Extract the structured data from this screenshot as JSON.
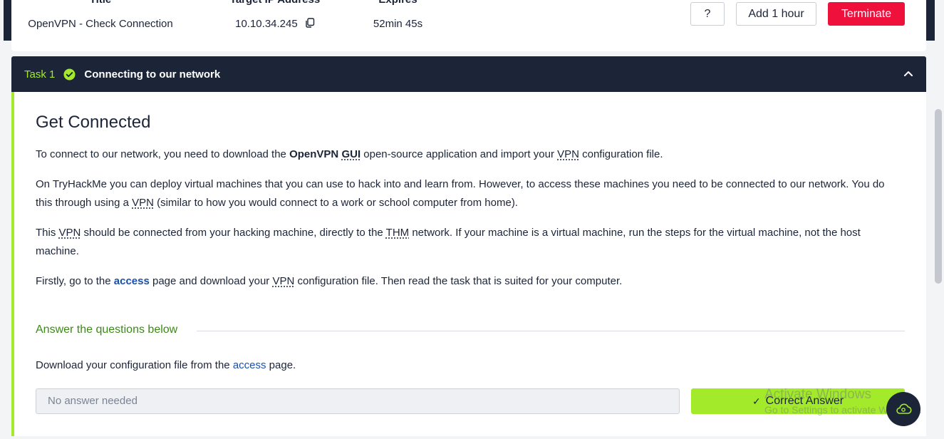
{
  "machine": {
    "title_header": "Title",
    "title_value": "OpenVPN - Check Connection",
    "ip_header": "Target IP Address",
    "ip_value": "10.10.34.245",
    "expires_header": "Expires",
    "expires_value": "52min 45s",
    "help_label": "?",
    "add_hour_label": "Add 1 hour",
    "terminate_label": "Terminate"
  },
  "task": {
    "number": "Task 1",
    "title": "Connecting to our network",
    "heading": "Get Connected",
    "p1": {
      "t1": "To connect to our network, you need to download the ",
      "b1": "OpenVPN ",
      "b1_abbr": "GUI",
      "t2": " open-source application and import your ",
      "abbr1": "VPN",
      "t3": " configuration file."
    },
    "p2": {
      "t1": "On TryHackMe you can deploy virtual machines that you can use to hack into and learn from. However, to access these machines you need to be connected to our network. You do this through using a ",
      "abbr1": "VPN",
      "t2": " (similar to how you would connect to a work or school computer from home)."
    },
    "p3": {
      "t1": "This ",
      "abbr1": "VPN",
      "t2": " should be connected from your hacking machine, directly to the ",
      "abbr2": "THM",
      "t3": " network. If your machine is a virtual machine, run the steps for the virtual machine, not the host machine."
    },
    "p4": {
      "t1": "Firstly, go to the ",
      "link": "access",
      "t2": " page and download your ",
      "abbr1": "VPN",
      "t3": " configuration file. Then read the task that is suited for your computer."
    },
    "answers_heading": "Answer the questions below",
    "question": {
      "t1": "Download your configuration file from the ",
      "link": "access",
      "t2": " page."
    },
    "answer_value": "No answer needed",
    "correct_label": "Correct Answer"
  },
  "watermark": {
    "line1": "Activate Windows",
    "line2": "Go to Settings to activate Windows."
  },
  "colors": {
    "navy": "#1c2538",
    "lime": "#a3ea2a",
    "terminate": "#f0103c",
    "link": "#1b4fa8"
  }
}
